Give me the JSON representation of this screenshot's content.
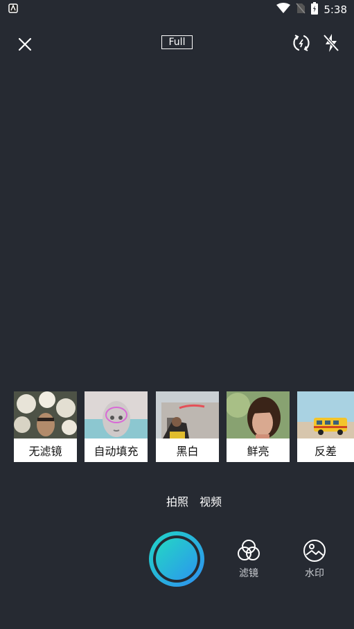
{
  "status": {
    "time": "5:38"
  },
  "top": {
    "mode_label": "Full"
  },
  "filters": [
    {
      "label": "无滤镜",
      "icon": "flowers-portrait-thumb"
    },
    {
      "label": "自动填充",
      "icon": "mask-face-thumb"
    },
    {
      "label": "黑白",
      "icon": "building-neon-thumb"
    },
    {
      "label": "鲜亮",
      "icon": "woman-portrait-thumb"
    },
    {
      "label": "反差",
      "icon": "toy-bus-thumb"
    }
  ],
  "modes": {
    "photo": "拍照",
    "video": "视频"
  },
  "actions": {
    "filter_label": "滤镜",
    "watermark_label": "水印"
  },
  "colors": {
    "background": "#262a32",
    "shutter_start": "#20d5c6",
    "shutter_end": "#2f8ff0"
  }
}
